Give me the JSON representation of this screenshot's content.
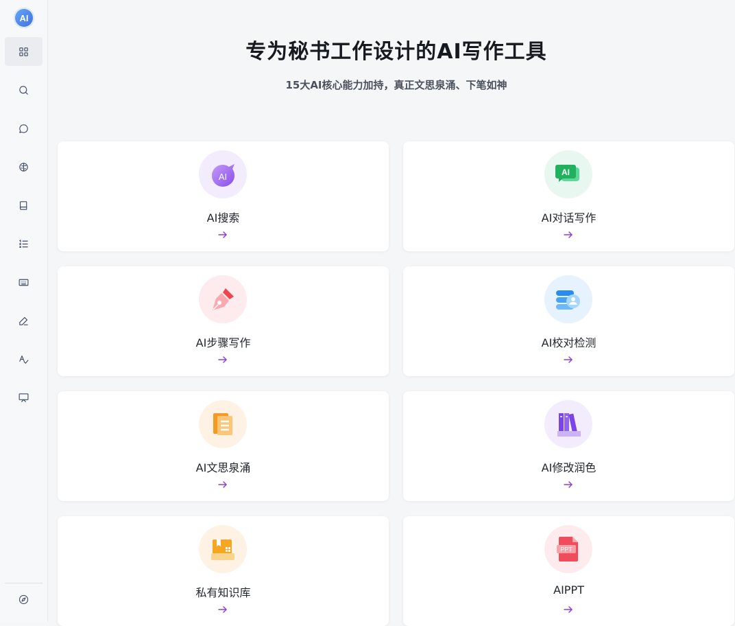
{
  "sidebar": {
    "logo_text": "AI",
    "items": [
      {
        "icon": "grid-icon"
      },
      {
        "icon": "search-icon"
      },
      {
        "icon": "chat-bubble-icon"
      },
      {
        "icon": "brain-icon"
      },
      {
        "icon": "book-icon"
      },
      {
        "icon": "list-icon"
      },
      {
        "icon": "keyboard-icon"
      },
      {
        "icon": "pen-icon"
      },
      {
        "icon": "spellcheck-icon"
      },
      {
        "icon": "presentation-icon"
      }
    ],
    "bottom_icon": "compass-icon"
  },
  "hero": {
    "title": "专为秘书工作设计的AI写作工具",
    "subtitle": "15大AI核心能力加持，真正文思泉涌、下笔如神"
  },
  "cards": [
    {
      "label": "AI搜索",
      "icon": "ai-search-icon",
      "bg": "#f3ecfd",
      "color": "#9b5cf0"
    },
    {
      "label": "AI对话写作",
      "icon": "ai-chat-icon",
      "bg": "#e8f7ef",
      "color": "#22b866"
    },
    {
      "label": "AI步骤写作",
      "icon": "pen-nib-icon",
      "bg": "#fdebee",
      "color": "#f04d5c"
    },
    {
      "label": "AI校对检测",
      "icon": "proofread-icon",
      "bg": "#e6f2fd",
      "color": "#2d8ff0"
    },
    {
      "label": "AI文思泉涌",
      "icon": "document-icon",
      "bg": "#fdf2e4",
      "color": "#f59a23"
    },
    {
      "label": "AI修改润色",
      "icon": "books-icon",
      "bg": "#f2ecfd",
      "color": "#8b5cf0"
    },
    {
      "label": "私有知识库",
      "icon": "knowledge-box-icon",
      "bg": "#fdf2e4",
      "color": "#f5a623"
    },
    {
      "label": "AIPPT",
      "icon": "ppt-icon",
      "bg": "#fdebee",
      "color": "#f04d5c",
      "badge": "PPT"
    }
  ]
}
